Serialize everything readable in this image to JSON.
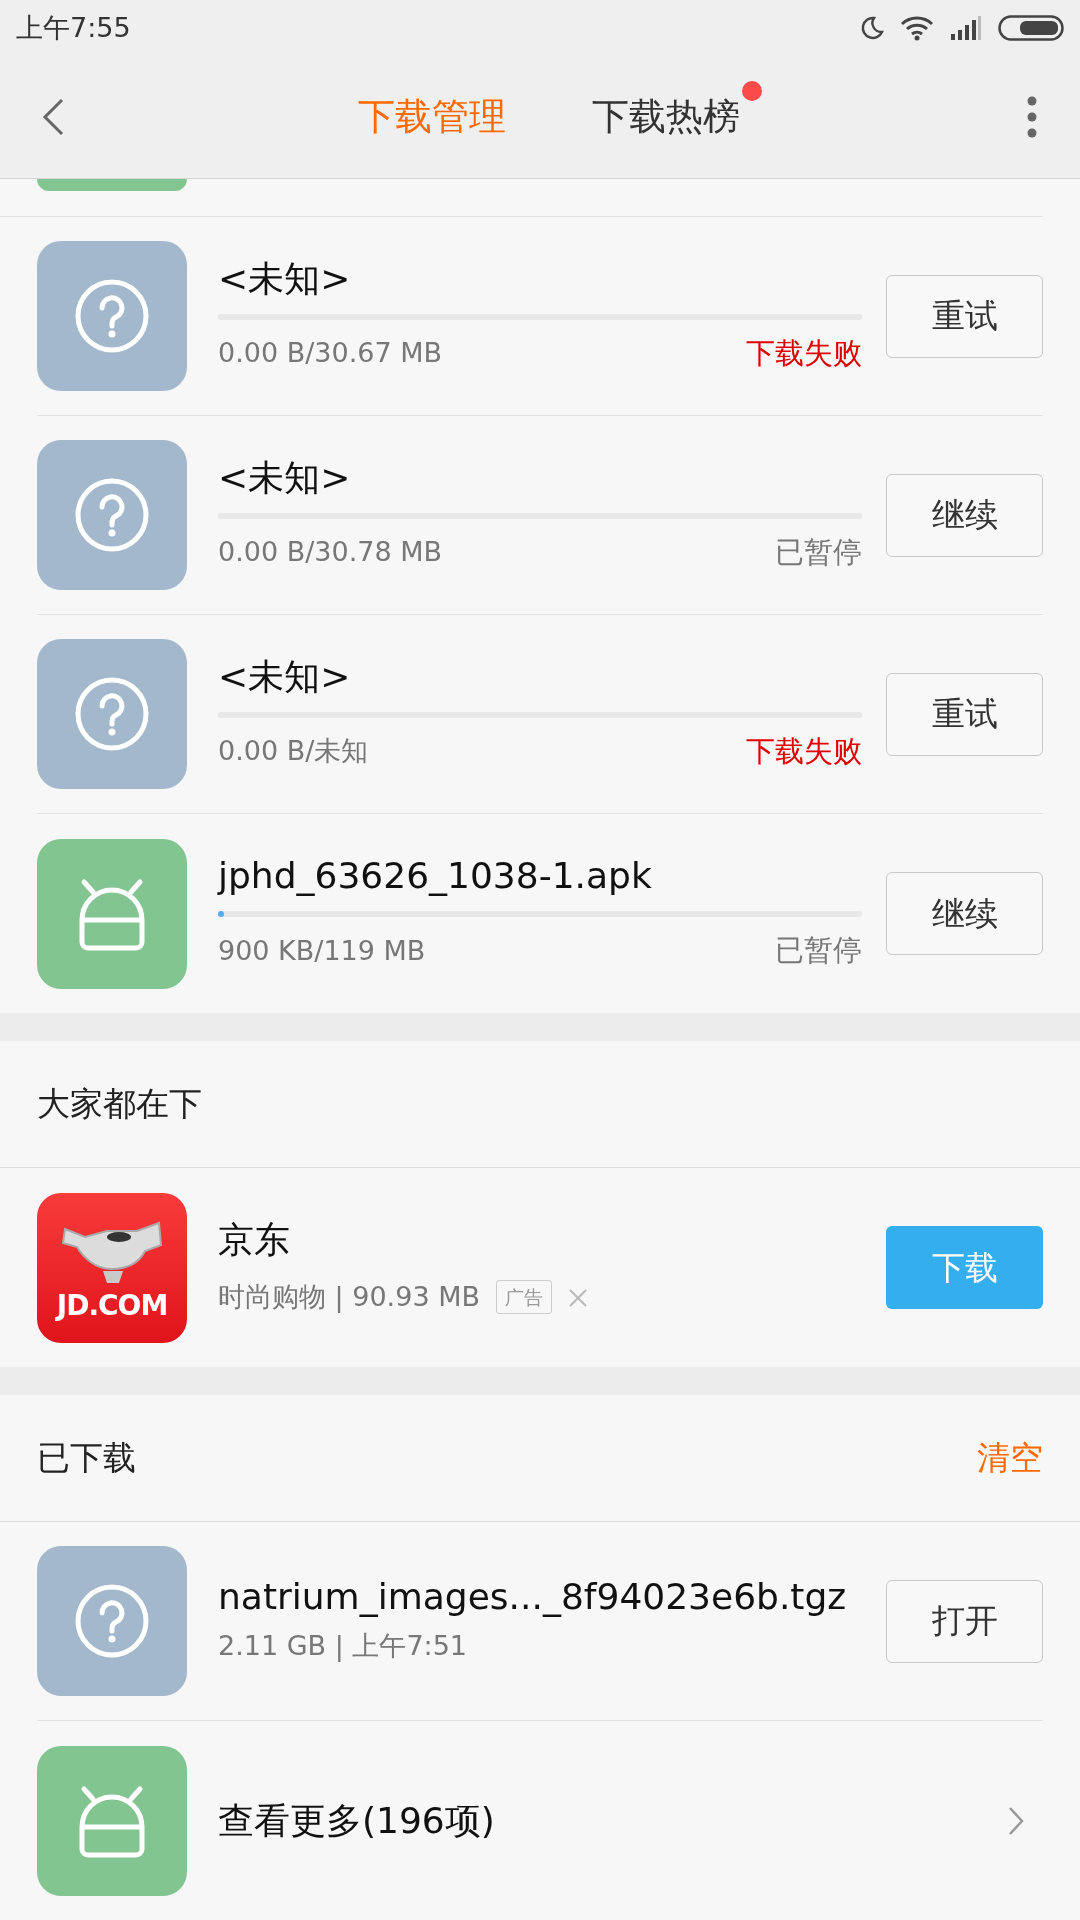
{
  "status_bar": {
    "time": "上午7:55"
  },
  "tabs": [
    {
      "label": "下载管理",
      "selected": true,
      "dot": false
    },
    {
      "label": "下载热榜",
      "selected": false,
      "dot": true
    }
  ],
  "downloads": [
    {
      "kind": "unknown",
      "name": "<未知>",
      "size": "0.00 B/30.67 MB",
      "status": "下载失败",
      "failed": true,
      "button": "重试"
    },
    {
      "kind": "unknown",
      "name": "<未知>",
      "size": "0.00 B/30.78 MB",
      "status": "已暂停",
      "failed": false,
      "button": "继续"
    },
    {
      "kind": "unknown",
      "name": "<未知>",
      "size": "0.00 B/未知",
      "status": "下载失败",
      "failed": true,
      "button": "重试"
    },
    {
      "kind": "apk",
      "name": "jphd_63626_1038-1.apk",
      "level": 0.01,
      "size": "900 KB/119 MB",
      "status": "已暂停",
      "failed": false,
      "button": "继续"
    }
  ],
  "recommend": {
    "title": "大家都在下",
    "app": {
      "logo_text": "JD.COM",
      "name": "京东",
      "meta": "时尚购物 | 90.93 MB",
      "ad_tag": "广告",
      "button": "下载"
    }
  },
  "downloaded": {
    "title": "已下载",
    "clear": "清空",
    "items": [
      {
        "kind": "file",
        "name": "natrium_images..._8f94023e6b.tgz",
        "meta": "2.11 GB | 上午7:51",
        "button": "打开"
      },
      {
        "kind": "more",
        "name": "查看更多(196项)"
      }
    ]
  }
}
